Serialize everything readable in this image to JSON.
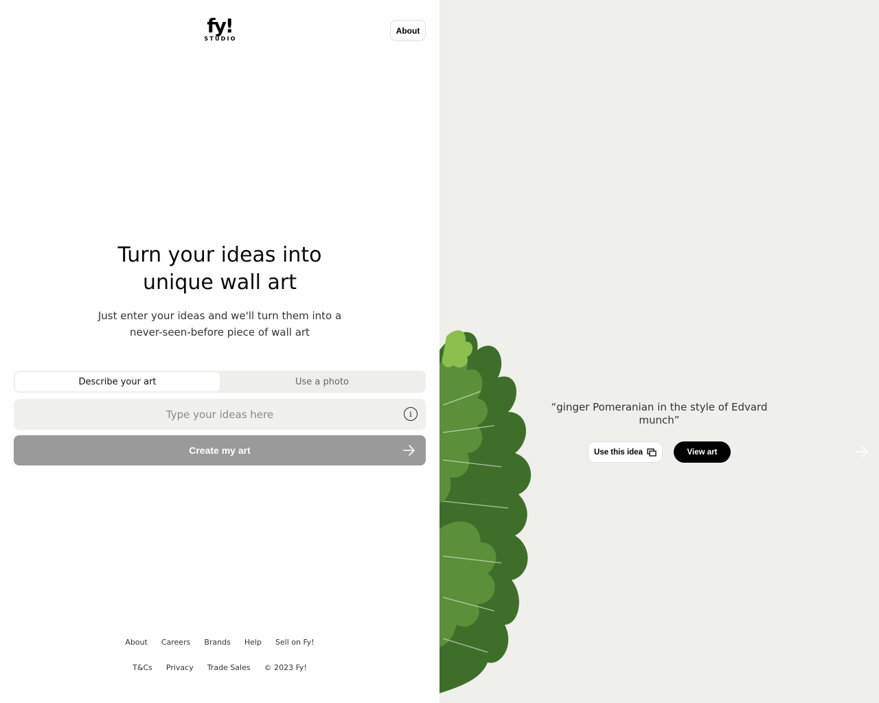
{
  "header": {
    "logo_text": "fy!",
    "logo_sub": "STUDIO",
    "about_label": "About"
  },
  "hero": {
    "title_line1": "Turn your ideas into",
    "title_line2": "unique wall art",
    "subtitle_line1": "Just enter your ideas and we'll turn them into a",
    "subtitle_line2": "never-seen-before piece of wall art"
  },
  "tabs": [
    {
      "label": "Describe your art",
      "active": true
    },
    {
      "label": "Use a photo",
      "active": false
    }
  ],
  "input": {
    "value": "",
    "placeholder": "Type your ideas here"
  },
  "create_button": {
    "label": "Create my art"
  },
  "footer": {
    "row1": [
      "About",
      "Careers",
      "Brands",
      "Help",
      "Sell on Fy!"
    ],
    "row2": [
      "T&Cs",
      "Privacy",
      "Trade Sales",
      "© 2023 Fy!"
    ]
  },
  "showcase": {
    "quote": "“ginger Pomeranian in the style of Edvard munch”",
    "use_idea_label": "Use this idea",
    "view_art_label": "View art"
  },
  "icons": {
    "info": "info-icon",
    "arrow": "arrow-right-icon",
    "copy": "copy-icon",
    "next": "next-arrow-icon"
  },
  "colors": {
    "right_bg": "#efefeb",
    "button_disabled": "#9a9a9a",
    "tab_bg": "#eeeeea",
    "input_bg": "#f0f0ec",
    "primary": "#000000"
  }
}
